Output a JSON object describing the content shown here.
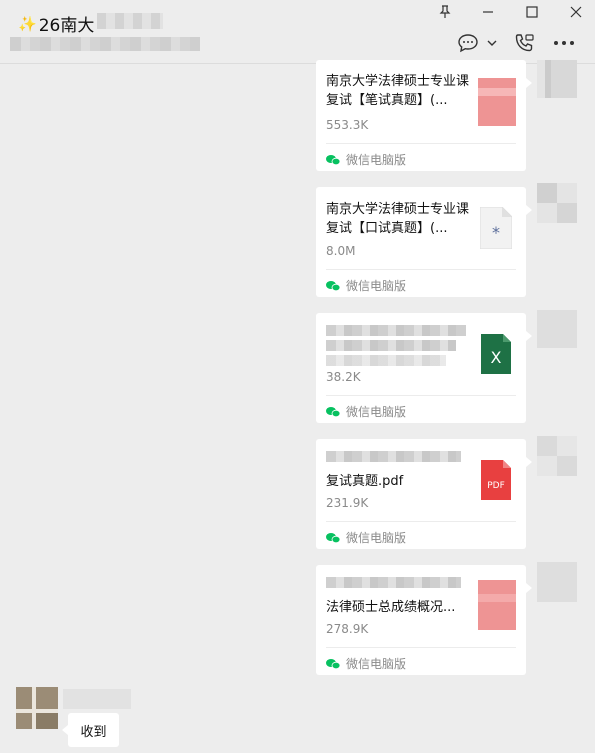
{
  "header": {
    "title_emoji": "✨",
    "title": "26南大"
  },
  "window_controls": {
    "pin_icon": "pin-icon",
    "minimize_icon": "minimize-icon",
    "maximize_icon": "maximize-icon",
    "close_icon": "close-icon"
  },
  "toolbar": {
    "chat_icon": "chat-bubble-icon",
    "dropdown_icon": "chevron-down-icon",
    "call_icon": "phone-icon",
    "more_icon": "more-icon"
  },
  "messages": [
    {
      "name": "南京大学法律硕士专业课复试【笔试真题】(...",
      "size": "553.3K",
      "source": "微信电脑版",
      "file_icon": "file-pink-icon"
    },
    {
      "name": "南京大学法律硕士专业课复试【口试真题】(...",
      "size": "8.0M",
      "source": "微信电脑版",
      "file_icon": "file-generic-icon"
    },
    {
      "name": "",
      "size": "38.2K",
      "source": "微信电脑版",
      "file_icon": "excel-icon"
    },
    {
      "name": "复试真题.pdf",
      "size": "231.9K",
      "source": "微信电脑版",
      "file_icon": "pdf-icon"
    },
    {
      "name": "法律硕士总成绩概况...",
      "size": "278.9K",
      "source": "微信电脑版",
      "file_icon": "file-pink-icon"
    }
  ],
  "reply": {
    "text": "收到"
  },
  "colors": {
    "background": "#ededed",
    "bubble": "#ffffff",
    "wechat_green": "#07c160",
    "excel_green": "#1e7145",
    "pdf_red": "#e84040",
    "pink_file": "#f0a0a0"
  }
}
